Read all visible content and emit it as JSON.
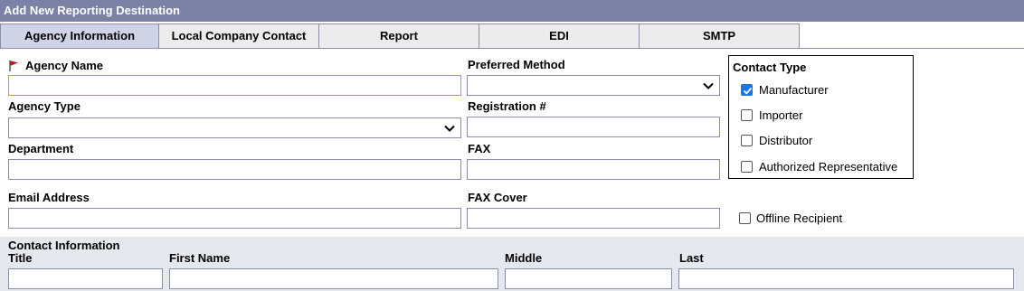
{
  "window": {
    "title": "Add New Reporting Destination"
  },
  "tabs": [
    {
      "label": "Agency Information",
      "active": true
    },
    {
      "label": "Local Company Contact",
      "active": false
    },
    {
      "label": "Report",
      "active": false
    },
    {
      "label": "EDI",
      "active": false
    },
    {
      "label": "SMTP",
      "active": false
    }
  ],
  "fields": {
    "agency_name": {
      "label": "Agency Name",
      "value": "",
      "required": true
    },
    "agency_type": {
      "label": "Agency Type",
      "selected": ""
    },
    "department": {
      "label": "Department",
      "value": ""
    },
    "email": {
      "label": "Email Address",
      "value": ""
    },
    "preferred_method": {
      "label": "Preferred Method",
      "selected": ""
    },
    "registration": {
      "label": "Registration #",
      "value": ""
    },
    "fax": {
      "label": "FAX",
      "value": ""
    },
    "fax_cover": {
      "label": "FAX Cover",
      "value": ""
    }
  },
  "contact_type": {
    "title": "Contact Type",
    "options": [
      {
        "label": "Manufacturer",
        "checked": true
      },
      {
        "label": "Importer",
        "checked": false
      },
      {
        "label": "Distributor",
        "checked": false
      },
      {
        "label": "Authorized Representative",
        "checked": false
      }
    ]
  },
  "offline_recipient": {
    "label": "Offline Recipient",
    "checked": false
  },
  "contact_info": {
    "section_label": "Contact Information",
    "title_label": "Title",
    "first_name_label": "First Name",
    "middle_label": "Middle",
    "last_label": "Last"
  },
  "colors": {
    "titlebar": "#7b82a6",
    "active_tab": "#cfd3e6",
    "checkbox_checked": "#1a73e8",
    "required_flag": "#b22222",
    "focus_border": "#c9a227"
  }
}
